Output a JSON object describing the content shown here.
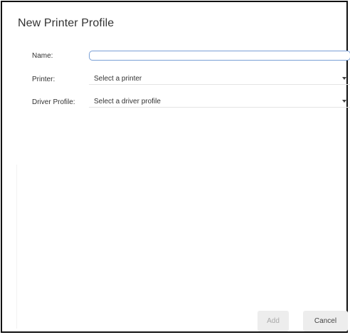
{
  "dialog": {
    "title": "New Printer Profile"
  },
  "form": {
    "name_label": "Name:",
    "name_value": "",
    "printer_label": "Printer:",
    "printer_selected": "Select a printer",
    "driver_profile_label": "Driver Profile:",
    "driver_profile_selected": "Select a driver profile"
  },
  "buttons": {
    "add_label": "Add",
    "add_enabled": false,
    "cancel_label": "Cancel"
  },
  "colors": {
    "input_focus_border": "#7aa0d6",
    "button_bg": "#ededed",
    "disabled_text": "#a9a9a9"
  },
  "icons": {
    "dropdown": "chevron-down-icon"
  }
}
